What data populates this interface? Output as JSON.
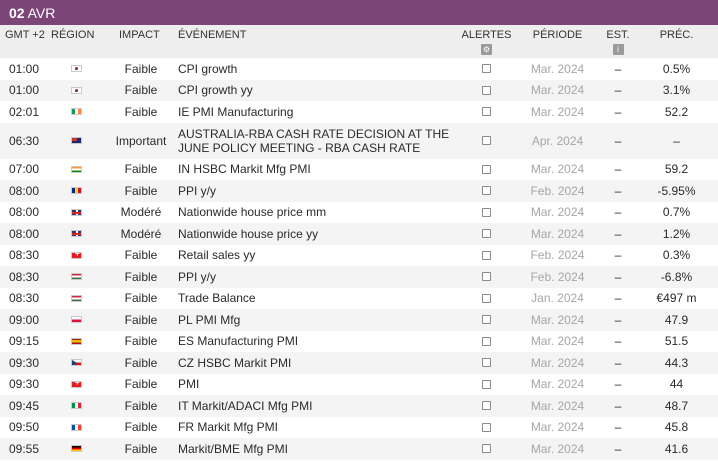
{
  "date": {
    "day": "02",
    "month": "AVR"
  },
  "columns": {
    "time": "GMT +2",
    "region": "RÉGION",
    "impact": "IMPACT",
    "event": "ÉVÉNEMENT",
    "alerts": "ALERTES",
    "period": "PÉRIODE",
    "est": "EST.",
    "prev": "PRÉC."
  },
  "icons": {
    "alerts_header": "gear-icon",
    "est_header": "info-icon"
  },
  "colors": {
    "date_bar": "#7b4578",
    "period_text": "#a6a6a6"
  },
  "events": [
    {
      "time": "01:00",
      "region": "kr",
      "impact": "Faible",
      "event": "CPI growth",
      "period": "Mar. 2024",
      "est": "–",
      "prev": "0.5%"
    },
    {
      "time": "01:00",
      "region": "kr",
      "impact": "Faible",
      "event": "CPI growth yy",
      "period": "Mar. 2024",
      "est": "–",
      "prev": "3.1%"
    },
    {
      "time": "02:01",
      "region": "ie",
      "impact": "Faible",
      "event": "IE PMI Manufacturing",
      "period": "Mar. 2024",
      "est": "–",
      "prev": "52.2"
    },
    {
      "time": "06:30",
      "region": "au",
      "impact": "Important",
      "event": "AUSTRALIA-RBA CASH RATE DECISION AT THE JUNE POLICY MEETING - RBA CASH RATE",
      "period": "Apr. 2024",
      "est": "–",
      "prev": "–",
      "tall": true
    },
    {
      "time": "07:00",
      "region": "in",
      "impact": "Faible",
      "event": "IN HSBC Markit Mfg PMI",
      "period": "Mar. 2024",
      "est": "–",
      "prev": "59.2"
    },
    {
      "time": "08:00",
      "region": "ro",
      "impact": "Faible",
      "event": "PPI y/y",
      "period": "Feb. 2024",
      "est": "–",
      "prev": "-5.95%"
    },
    {
      "time": "08:00",
      "region": "gb",
      "impact": "Modéré",
      "event": "Nationwide house price mm",
      "period": "Mar. 2024",
      "est": "–",
      "prev": "0.7%"
    },
    {
      "time": "08:00",
      "region": "gb",
      "impact": "Modéré",
      "event": "Nationwide house price yy",
      "period": "Mar. 2024",
      "est": "–",
      "prev": "1.2%"
    },
    {
      "time": "08:30",
      "region": "ch",
      "impact": "Faible",
      "event": "Retail sales yy",
      "period": "Feb. 2024",
      "est": "–",
      "prev": "0.3%"
    },
    {
      "time": "08:30",
      "region": "hu",
      "impact": "Faible",
      "event": "PPI y/y",
      "period": "Feb. 2024",
      "est": "–",
      "prev": "-6.8%"
    },
    {
      "time": "08:30",
      "region": "hu",
      "impact": "Faible",
      "event": "Trade Balance",
      "period": "Jan. 2024",
      "est": "–",
      "prev": "€497 m"
    },
    {
      "time": "09:00",
      "region": "pl",
      "impact": "Faible",
      "event": "PL PMI Mfg",
      "period": "Mar. 2024",
      "est": "–",
      "prev": "47.9"
    },
    {
      "time": "09:15",
      "region": "es",
      "impact": "Faible",
      "event": "ES Manufacturing PMI",
      "period": "Mar. 2024",
      "est": "–",
      "prev": "51.5"
    },
    {
      "time": "09:30",
      "region": "cz",
      "impact": "Faible",
      "event": "CZ HSBC Markit PMI",
      "period": "Mar. 2024",
      "est": "–",
      "prev": "44.3"
    },
    {
      "time": "09:30",
      "region": "ch",
      "impact": "Faible",
      "event": "PMI",
      "period": "Mar. 2024",
      "est": "–",
      "prev": "44"
    },
    {
      "time": "09:45",
      "region": "it",
      "impact": "Faible",
      "event": "IT Markit/ADACI Mfg PMI",
      "period": "Mar. 2024",
      "est": "–",
      "prev": "48.7"
    },
    {
      "time": "09:50",
      "region": "fr",
      "impact": "Faible",
      "event": "FR Markit Mfg PMI",
      "period": "Mar. 2024",
      "est": "–",
      "prev": "45.8"
    },
    {
      "time": "09:55",
      "region": "de",
      "impact": "Faible",
      "event": "Markit/BME Mfg PMI",
      "period": "Mar. 2024",
      "est": "–",
      "prev": "41.6"
    }
  ]
}
